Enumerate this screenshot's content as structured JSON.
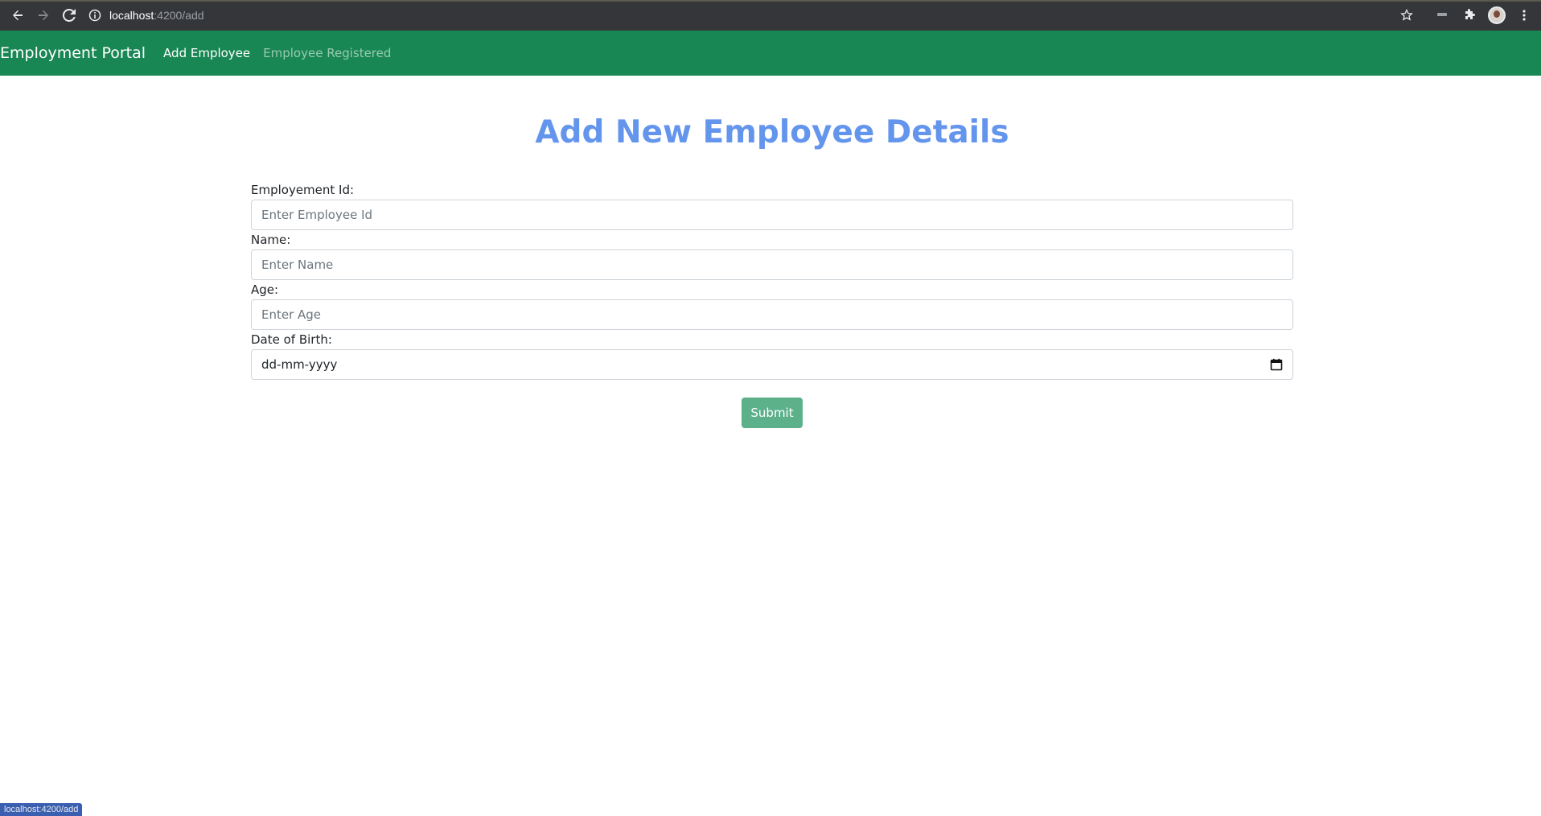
{
  "browser": {
    "url_host": "localhost",
    "url_path": ":4200/add",
    "status_url": "localhost:4200/add"
  },
  "navbar": {
    "brand": "Employment Portal",
    "links": [
      {
        "label": "Add Employee",
        "active": true
      },
      {
        "label": "Employee Registered",
        "active": false
      }
    ]
  },
  "main": {
    "title": "Add New Employee Details",
    "fields": [
      {
        "label": "Employement Id:",
        "placeholder": "Enter Employee Id",
        "value": ""
      },
      {
        "label": "Name:",
        "placeholder": "Enter Name",
        "value": ""
      },
      {
        "label": "Age:",
        "placeholder": "Enter Age",
        "value": ""
      },
      {
        "label": "Date of Birth:",
        "placeholder": "dd-mm-yyyy",
        "value": ""
      }
    ],
    "submit_label": "Submit"
  },
  "colors": {
    "navbar_bg": "#198754",
    "title": "#6495ed",
    "submit_bg": "#5cb08a"
  },
  "icons": [
    "back-arrow-icon",
    "forward-arrow-icon",
    "reload-icon",
    "info-icon",
    "star-icon",
    "tab-search-icon",
    "extensions-icon",
    "profile-avatar",
    "more-menu-icon",
    "calendar-icon"
  ]
}
